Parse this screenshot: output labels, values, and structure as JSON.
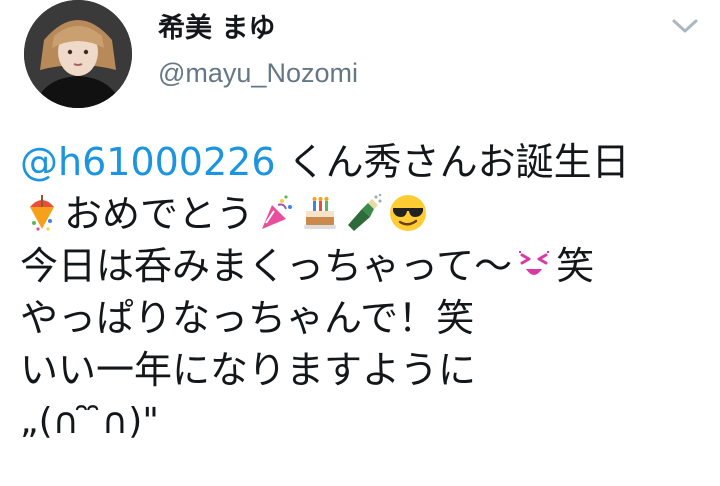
{
  "user": {
    "display_name": "希美 まゆ",
    "handle": "@mayu_Nozomi"
  },
  "tweet": {
    "mention": "@h61000226",
    "line1_rest": " くん秀さんお誕生日",
    "line2_text": "おめでとう",
    "line3_text": "今日は呑みまくっちゃって〜",
    "line3_tail": "笑",
    "line4": "やっぱりなっちゃんで！笑",
    "line5": "いい一年になりますように",
    "line6": "„(∩ ̑ ̑∩)\""
  },
  "icons": {
    "line2_leading": "party-popper-icon",
    "line2_emojis": [
      "confetti-popper-icon",
      "birthday-cake-icon",
      "champagne-bottle-icon",
      "sunglasses-face-icon"
    ],
    "line3_emoji": "squinting-face-icon",
    "menu": "chevron-down-icon"
  },
  "colors": {
    "mention": "#1b95e0",
    "handle": "#657786",
    "text": "#14171a"
  }
}
